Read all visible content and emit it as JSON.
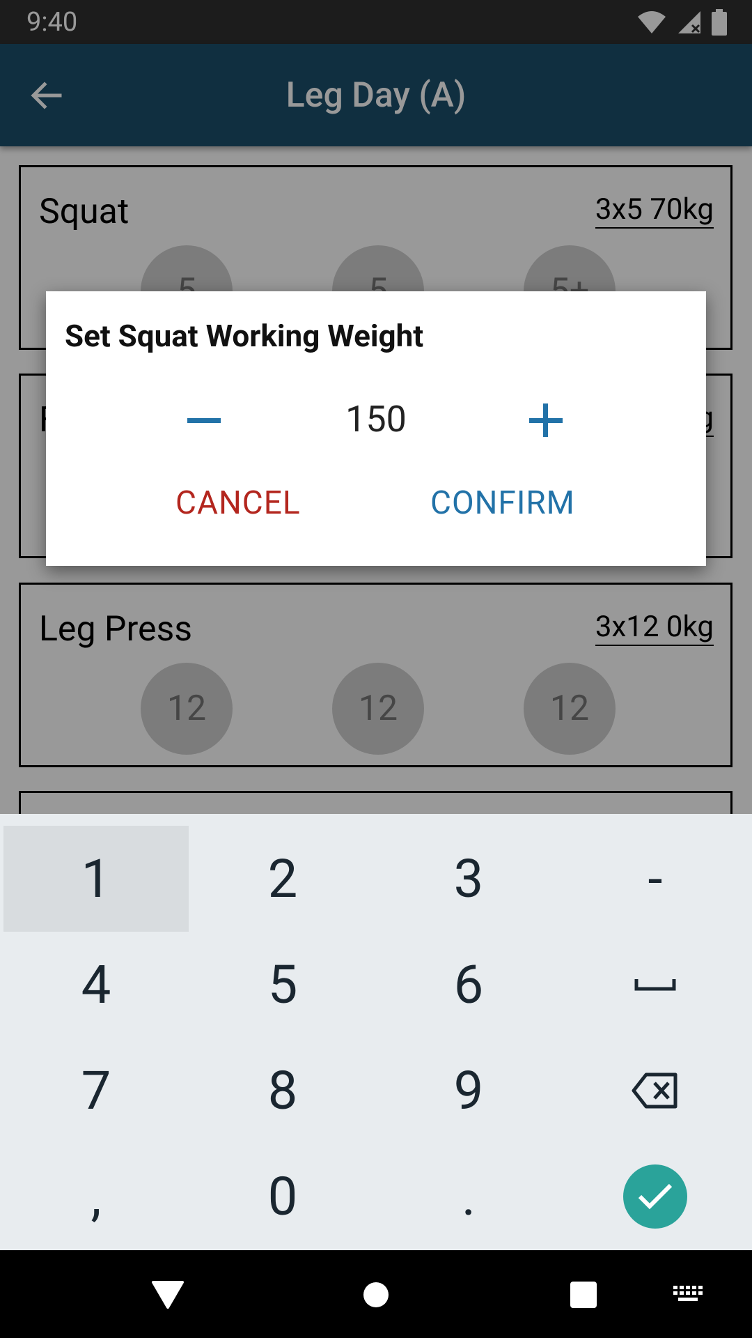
{
  "status_bar": {
    "time": "9:40"
  },
  "app_bar": {
    "title": "Leg Day (A)",
    "back_icon": "arrow-back-icon"
  },
  "cards": [
    {
      "name": "Squat",
      "scheme": "3x5 70kg",
      "sets": [
        "5",
        "5",
        "5+"
      ]
    },
    {
      "name": "F",
      "scheme": "g",
      "sets": []
    },
    {
      "name": "Leg Press",
      "scheme": "3x12 0kg",
      "sets": [
        "12",
        "12",
        "12"
      ]
    }
  ],
  "dialog": {
    "title": "Set Squat Working Weight",
    "value": "150",
    "minus_icon": "minus-icon",
    "plus_icon": "plus-icon",
    "cancel_label": "CANCEL",
    "confirm_label": "CONFIRM"
  },
  "keyboard": {
    "rows": [
      [
        "1",
        "2",
        "3",
        "-"
      ],
      [
        "4",
        "5",
        "6",
        "space"
      ],
      [
        "7",
        "8",
        "9",
        "backspace"
      ],
      [
        ",",
        "0",
        ".",
        "enter"
      ]
    ],
    "pressed_key": "1"
  },
  "nav_bar": {
    "icons": [
      "back-triangle-icon",
      "home-circle-icon",
      "recents-square-icon",
      "keyboard-switch-icon"
    ]
  }
}
